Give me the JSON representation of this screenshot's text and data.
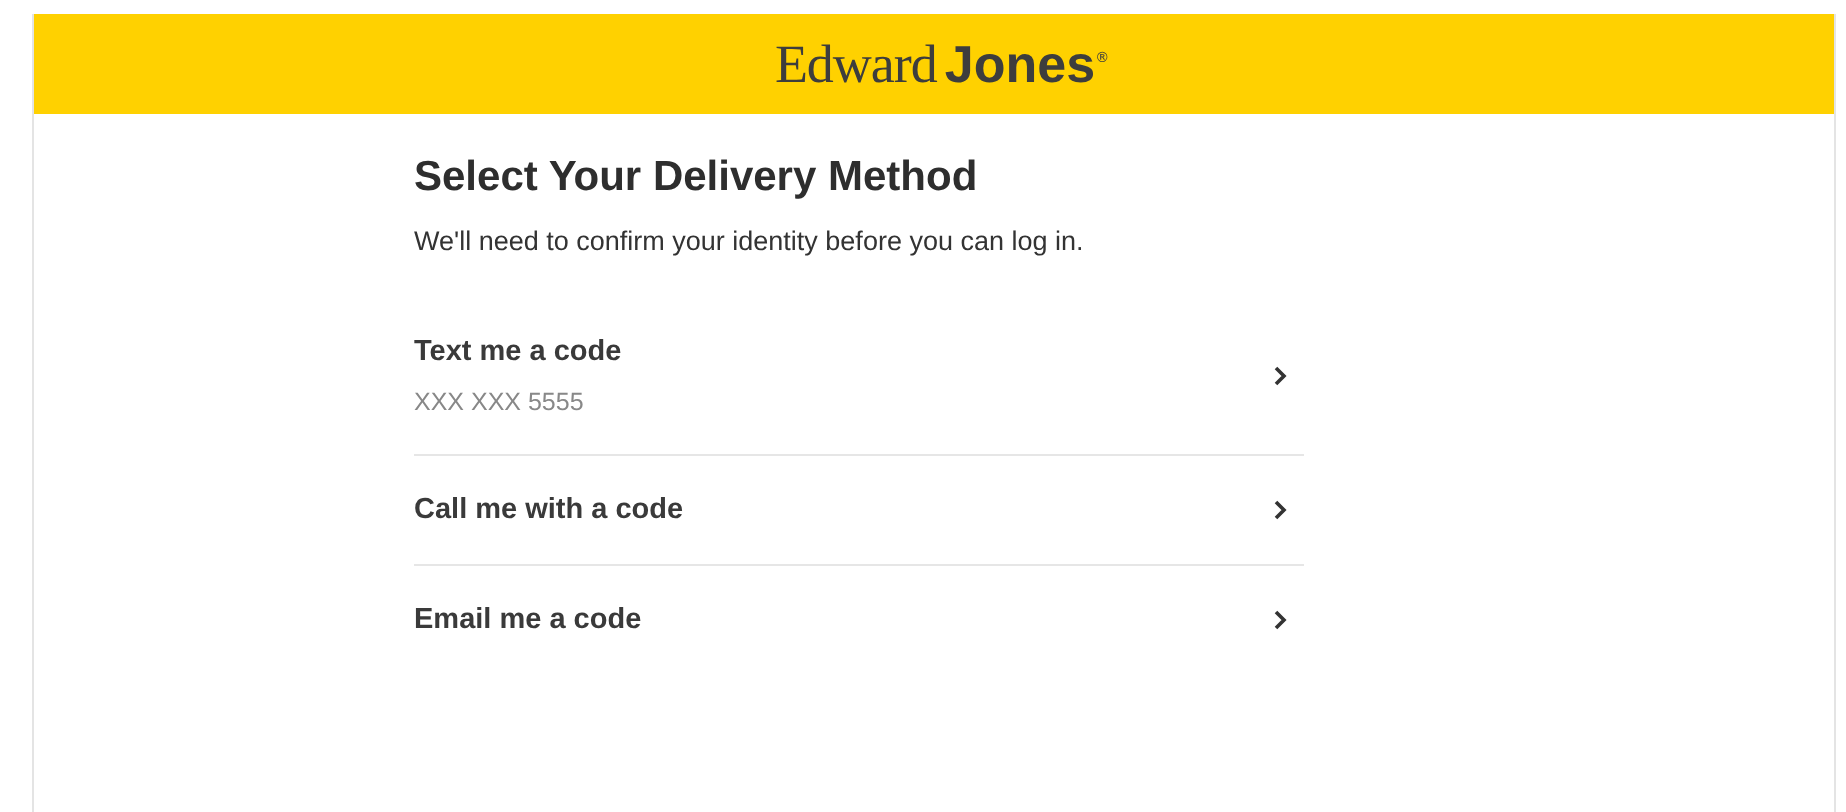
{
  "header": {
    "logo_first": "Edward",
    "logo_second": "Jones",
    "logo_mark": "®"
  },
  "title": "Select Your Delivery Method",
  "subtitle": "We'll need to confirm your identity before you can log in.",
  "options": [
    {
      "label": "Text me a code",
      "detail": "XXX XXX 5555"
    },
    {
      "label": "Call me with a code"
    },
    {
      "label": "Email me a code"
    }
  ]
}
